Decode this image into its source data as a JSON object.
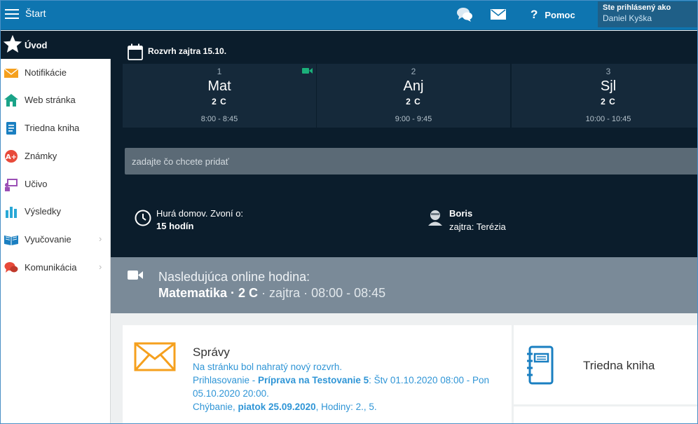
{
  "topbar": {
    "title": "Štart",
    "help_label": "Pomoc",
    "user_label": "Ste prihlásený ako",
    "user_name": "Daniel Kyška",
    "icons": [
      "menu-icon",
      "chat-icon",
      "mail-icon",
      "help-icon"
    ]
  },
  "sidebar": {
    "active": {
      "label": "Úvod",
      "icon": "star-icon"
    },
    "items": [
      {
        "label": "Notifikácie",
        "icon": "envelope-icon",
        "color": "#f5a01e"
      },
      {
        "label": "Web stránka",
        "icon": "house-icon",
        "color": "#1aa388"
      },
      {
        "label": "Triedna kniha",
        "icon": "notebook-icon",
        "color": "#1a7fc1"
      },
      {
        "label": "Známky",
        "icon": "grades-icon",
        "color": "#e84a3a"
      },
      {
        "label": "Učivo",
        "icon": "teaching-icon",
        "color": "#9b4fb5"
      },
      {
        "label": "Výsledky",
        "icon": "bar-chart-icon",
        "color": "#2aa8d6"
      },
      {
        "label": "Vyučovanie",
        "icon": "book-open-icon",
        "color": "#1a7fc1"
      },
      {
        "label": "Komunikácia",
        "icon": "chat-bubbles-icon",
        "color": "#e84a3a"
      }
    ]
  },
  "schedule": {
    "heading": "Rozvrh zajtra 15.10.",
    "lessons": [
      {
        "num": "1",
        "subject": "Mat",
        "class": "2 C",
        "time": "8:00 - 8:45",
        "online": true
      },
      {
        "num": "2",
        "subject": "Anj",
        "class": "2 C",
        "time": "9:00 - 9:45",
        "online": false
      },
      {
        "num": "3",
        "subject": "Sjl",
        "class": "2 C",
        "time": "10:00 - 10:45",
        "online": false
      }
    ]
  },
  "add_input": {
    "placeholder": "zadajte čo chcete pridať"
  },
  "bell": {
    "line1": "Hurá domov. Zvoní o:",
    "line2": "15 hodín"
  },
  "nameday": {
    "name": "Boris",
    "tomorrow": "zajtra: Terézia"
  },
  "online_lesson": {
    "label": "Nasledujúca online hodina:",
    "subject": "Matematika · 2 C",
    "when": " · zajtra · 08:00 - 08:45"
  },
  "messages": {
    "title": "Správy",
    "l1": "Na stránku bol nahratý nový rozvrh.",
    "l2a": "Prihlasovanie - ",
    "l2b": "Príprava na Testovanie 5",
    "l2c": ": Štv 01.10.2020 08:00 - Pon 05.10.2020 20:00.",
    "l3a": "Chýbanie, ",
    "l3b": "piatok 25.09.2020",
    "l3c": ", Hodiny: 2., 5."
  },
  "class_book_card": {
    "title": "Triedna kniha"
  },
  "colors": {
    "topbar": "#0e75b0",
    "dark": "#0b1d2c",
    "link": "#2f95d6",
    "online_bar": "#7a8a98",
    "accent_orange": "#f5a01e"
  }
}
